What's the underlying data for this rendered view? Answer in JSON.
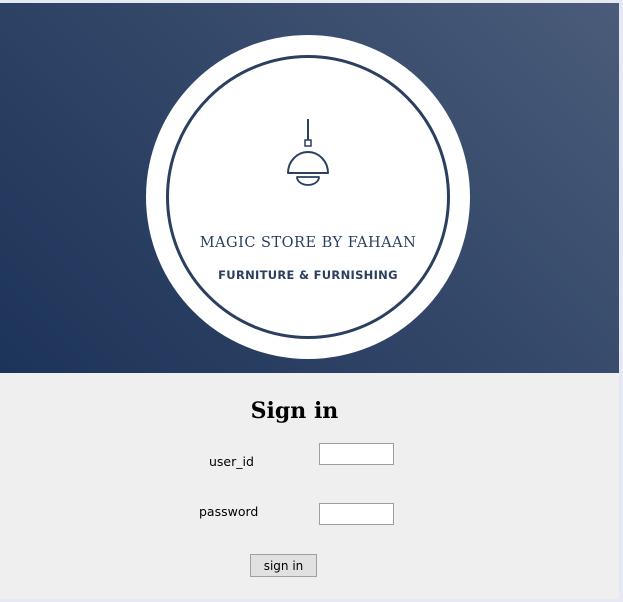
{
  "brand": {
    "name": "MAGIC STORE BY FAHAAN",
    "tagline": "FURNITURE & FURNISHING",
    "icon": "pendant-lamp-icon",
    "colors": {
      "banner_dark": "#1c3458",
      "banner_light": "#4a5c79",
      "logo_ink": "#2b3f5f"
    }
  },
  "form": {
    "title": "Sign in",
    "user_label": "user_id",
    "user_value": "",
    "password_label": "password",
    "password_value": "",
    "submit_label": "sign in"
  }
}
